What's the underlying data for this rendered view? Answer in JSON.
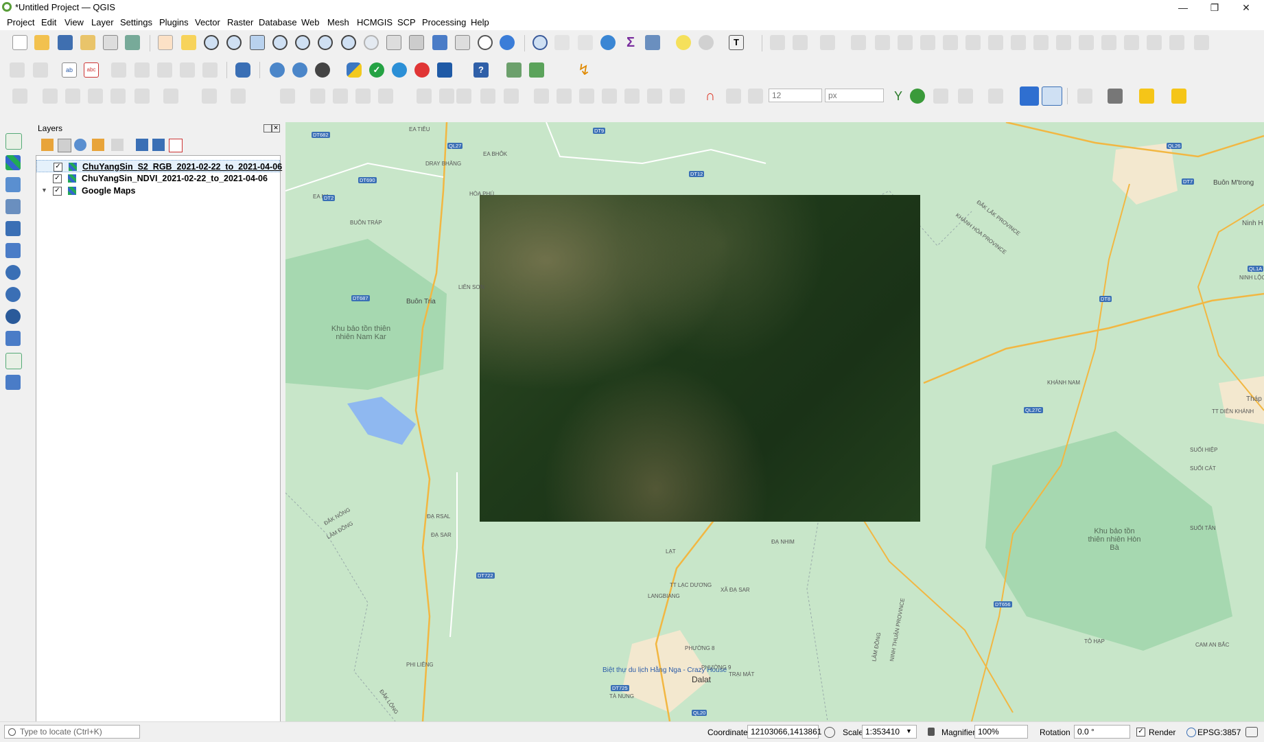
{
  "window": {
    "title": "*Untitled Project — QGIS",
    "minimize": "—",
    "restore": "❐",
    "close": "✕"
  },
  "menubar": {
    "items": [
      "Project",
      "Edit",
      "View",
      "Layer",
      "Settings",
      "Plugins",
      "Vector",
      "Raster",
      "Database",
      "Web",
      "Mesh",
      "HCMGIS",
      "SCP",
      "Processing",
      "Help"
    ]
  },
  "digitizing": {
    "snap_tolerance": "12",
    "snap_units": "px"
  },
  "layers_panel": {
    "title": "Layers",
    "layers": [
      {
        "name": "ChuYangSin_S2_RGB_2021-02-22_to_2021-04-06",
        "checked": true,
        "selected": true,
        "underline": true
      },
      {
        "name": "ChuYangSin_NDVI_2021-02-22_to_2021-04-06",
        "checked": true,
        "selected": false
      },
      {
        "name": "Google Maps",
        "checked": true,
        "selected": false,
        "expandable": true
      }
    ]
  },
  "map": {
    "places": [
      "Buôn M'trong",
      "Buôn Tria",
      "Khu bảo tồn thiên nhiên Nam Kar",
      "Khu bảo tồn thiên nhiên Hòn Bà",
      "Biệt thự du lịch Hằng Nga - Crazy House",
      "Dalat",
      "ĐẮK LẮK PROVINCE",
      "KHÁNH HÒA PROVINCE",
      "LÂM ĐỒNG",
      "NINH THUẬN PROVINCE",
      "LANGBIANG",
      "TT LẠC DƯƠNG",
      "PHƯỜNG 8",
      "PHƯỜNG 9",
      "TRẠI MÁT",
      "TÀ NUNG",
      "LẠT",
      "ĐẠ NHIM",
      "XÃ ĐẠ SAR",
      "ĐẠ RSAL",
      "PHI LIÊNG",
      "KHÁNH NAM",
      "SUỐI HIỆP",
      "SUỐI CÁT",
      "SUỐI TÂN",
      "TÔ HẠP",
      "CAM AN BẮC",
      "TT DIÊN KHÁNH",
      "Tháp B",
      "Ninh H",
      "NINH LỘC",
      "EA TIÊU",
      "EA BHÔK",
      "DRAY BHĂNG",
      "EA NA",
      "HÒA PHÚ",
      "BUÔN TRÁP",
      "LIÊN SƠN",
      "ĐẮK NÔNG",
      "ĐẠ SAR",
      "LÂM ĐỒNG",
      "ĐẮK LÔNG"
    ],
    "road_tags": [
      "QL27",
      "DT9",
      "DT682",
      "DT690",
      "DT12",
      "QL26",
      "DT687",
      "DT722",
      "QL27C",
      "DT656",
      "DT725",
      "QL20",
      "DT8",
      "DT2",
      "QL1A",
      "DT7"
    ]
  },
  "statusbar": {
    "locate_placeholder": "Type to locate (Ctrl+K)",
    "coordinate_label": "Coordinate",
    "coordinate_value": "12103066,1413861",
    "scale_label": "Scale",
    "scale_value": "1:353410",
    "magnifier_label": "Magnifier",
    "magnifier_value": "100%",
    "rotation_label": "Rotation",
    "rotation_value": "0.0 °",
    "render_label": "Render",
    "crs": "EPSG:3857"
  }
}
